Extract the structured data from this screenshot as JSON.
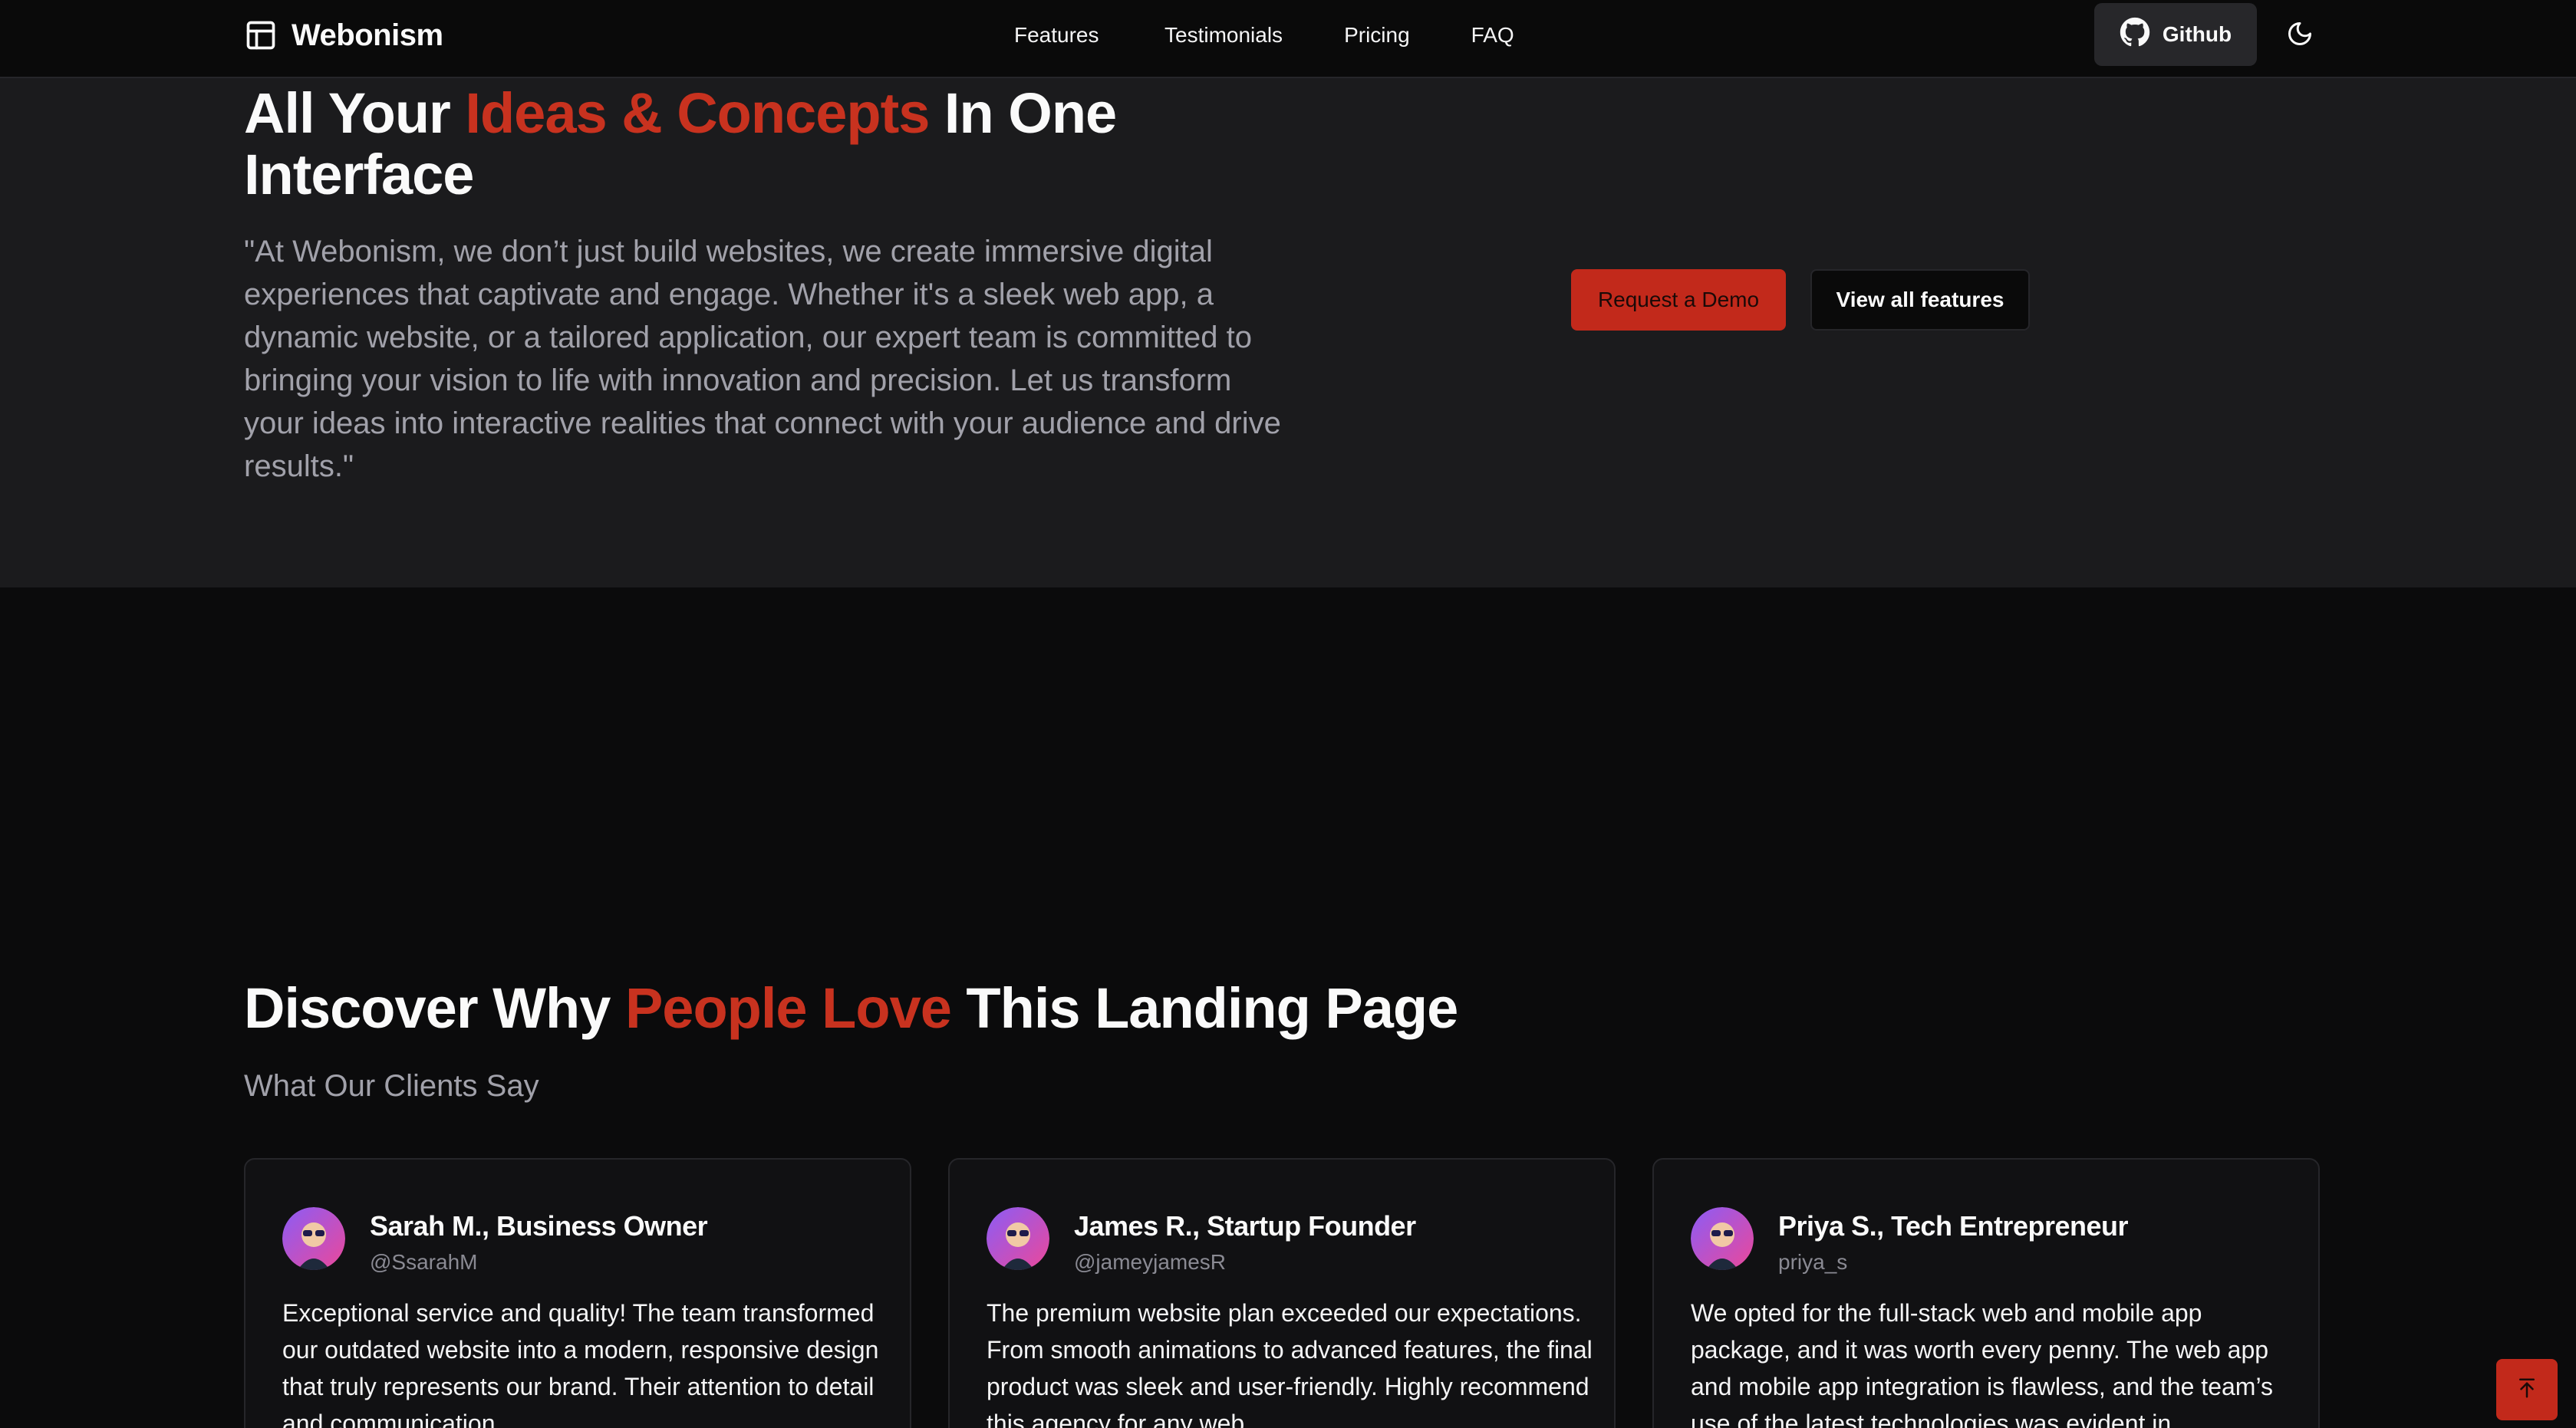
{
  "colors": {
    "accent": "#c8321f",
    "button_primary": "#c2291b",
    "background": "#0b0b0c",
    "hero_background": "#1b1b1d"
  },
  "navbar": {
    "brand": {
      "logo_icon": "panel-left-layout-icon",
      "name": "Webonism"
    },
    "links": [
      {
        "label": "Features"
      },
      {
        "label": "Testimonials"
      },
      {
        "label": "Pricing"
      },
      {
        "label": "FAQ"
      }
    ],
    "github_button": {
      "icon": "github-icon",
      "label": "Github"
    },
    "theme_toggle": {
      "icon": "moon-icon"
    }
  },
  "hero": {
    "title": {
      "part1": "All Your ",
      "accent": "Ideas & Concepts",
      "part2": " In One Interface"
    },
    "quote": "\"At Webonism, we don’t just build websites, we create immersive digital experiences that captivate and engage. Whether it's a sleek web app, a dynamic website, or a tailored application, our expert team is committed to bringing your vision to life with innovation and precision. Let us transform your ideas into interactive realities that connect with your audience and drive results.\"",
    "primary_button": "Request a Demo",
    "secondary_button": "View all features"
  },
  "testimonials": {
    "title": {
      "part1": "Discover Why ",
      "accent": "People Love",
      "part2": " This Landing Page"
    },
    "subtitle": "What Our Clients Say",
    "cards": [
      {
        "name": "Sarah M., Business Owner",
        "handle": "@SsarahM",
        "text": "Exceptional service and quality! The team transformed our outdated website into a modern, responsive design that truly represents our brand. Their attention to detail and communication"
      },
      {
        "name": "James R., Startup Founder",
        "handle": "@jameyjamesR",
        "text": "The premium website plan exceeded our expectations. From smooth animations to advanced features, the final product was sleek and user-friendly. Highly recommend this agency for any web"
      },
      {
        "name": "Priya S., Tech Entrepreneur",
        "handle": "priya_s",
        "text": "We opted for the full-stack web and mobile app package, and it was worth every penny. The web app and mobile app integration is flawless, and the team’s use of the latest technologies was evident in"
      }
    ]
  },
  "scroll_top_button": {
    "icon": "arrow-up-to-line-icon"
  }
}
